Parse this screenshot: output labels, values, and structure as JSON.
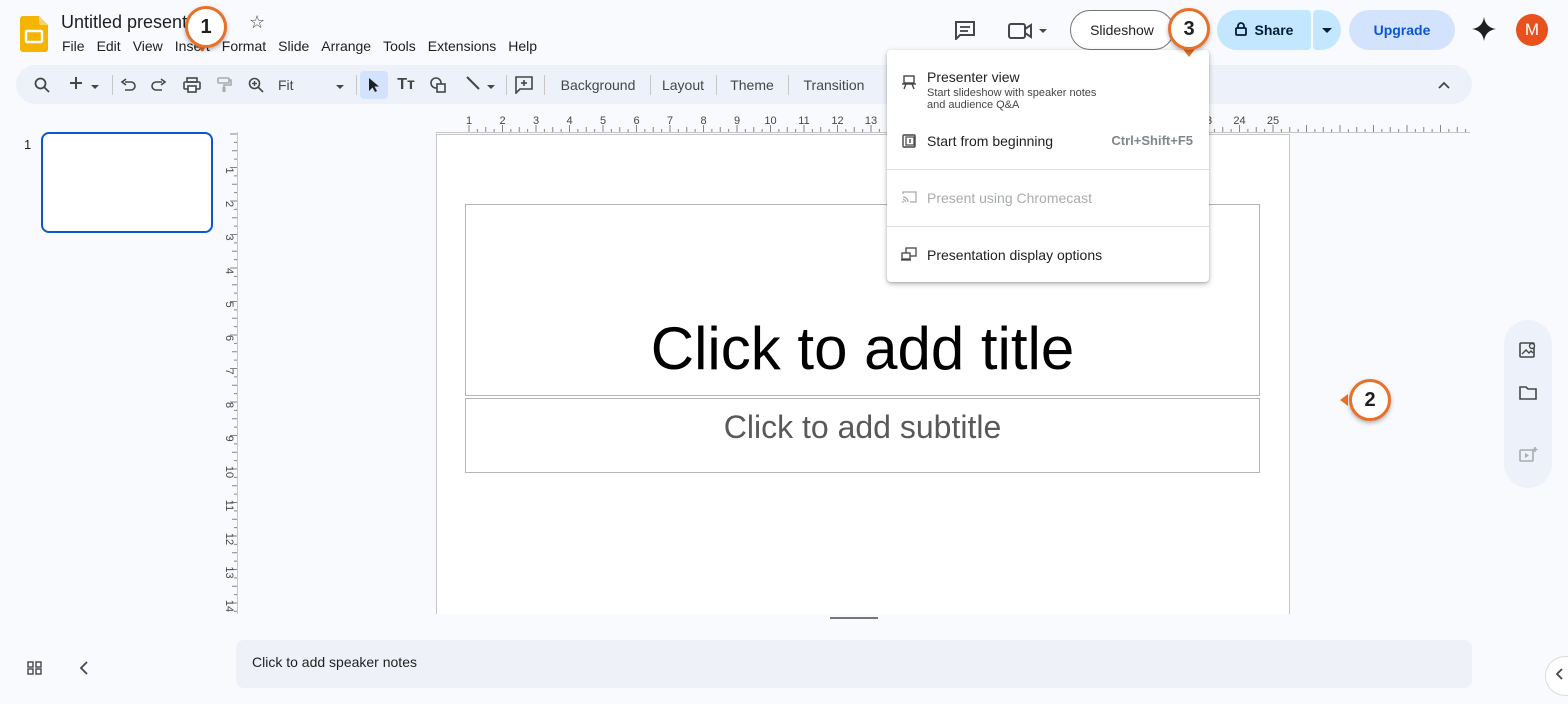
{
  "app": {
    "doc_title": "Untitled presentation",
    "menus": [
      "File",
      "Edit",
      "View",
      "Insert",
      "Format",
      "Slide",
      "Arrange",
      "Tools",
      "Extensions",
      "Help"
    ]
  },
  "header": {
    "slideshow_label": "Slideshow",
    "share_label": "Share",
    "upgrade_label": "Upgrade",
    "avatar_initial": "M"
  },
  "toolbar": {
    "zoom_value": "Fit",
    "background_label": "Background",
    "layout_label": "Layout",
    "theme_label": "Theme",
    "transition_label": "Transition"
  },
  "filmstrip": {
    "slide_number": "1"
  },
  "rulers": {
    "horizontal_ticks": [
      "1",
      "2",
      "3",
      "4",
      "5",
      "6",
      "7",
      "8",
      "9",
      "10",
      "11",
      "12",
      "13",
      "23",
      "24",
      "25"
    ],
    "vertical_ticks": [
      "1",
      "2",
      "3",
      "4",
      "5",
      "6",
      "7",
      "8",
      "9",
      "10",
      "11",
      "12",
      "13",
      "14"
    ]
  },
  "slide": {
    "title_placeholder": "Click to add title",
    "subtitle_placeholder": "Click to add subtitle"
  },
  "notes": {
    "placeholder": "Click to add speaker notes"
  },
  "slideshow_menu": {
    "presenter_view_label": "Presenter view",
    "presenter_view_sub_1": "Start slideshow with speaker notes",
    "presenter_view_sub_2": "and audience Q&A",
    "start_beginning_label": "Start from beginning",
    "start_beginning_shortcut": "Ctrl+Shift+F5",
    "chromecast_label": "Present using Chromecast",
    "display_options_label": "Presentation display options"
  },
  "badges": {
    "one": "1",
    "two": "2",
    "three": "3",
    "color": "#e8712a"
  },
  "colors": {
    "accent": "#0b57d0",
    "share_bg": "#c2e7ff",
    "upgrade_bg": "#d3e3fd",
    "avatar_bg": "#e8501c",
    "slides_logo": "#f4b400"
  }
}
